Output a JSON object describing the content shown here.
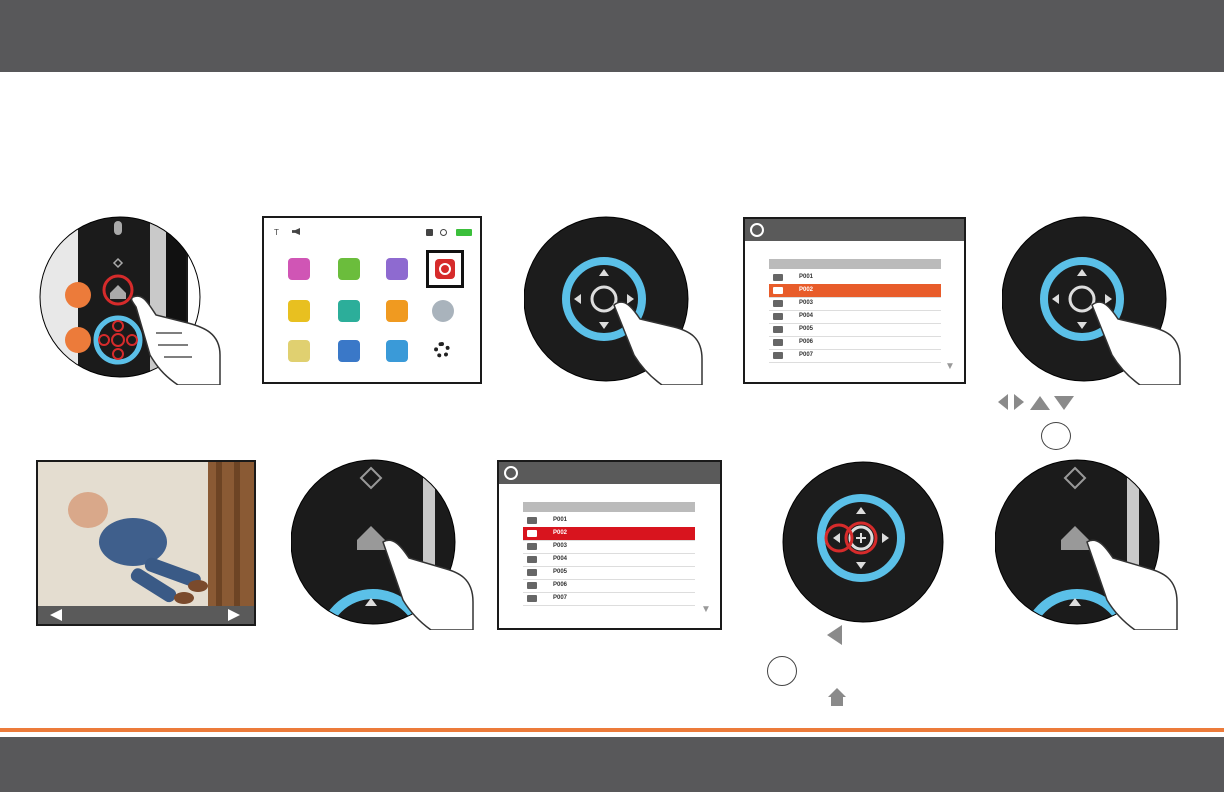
{
  "colors": {
    "header_bar": "#58585a",
    "accent_orange": "#ec7b3a",
    "selected_row_orange": "#e85c2a",
    "selected_row_red": "#d8141e",
    "ring_blue": "#5bc0e8",
    "highlight_red": "#d62b2b"
  },
  "steps": [
    {
      "id": 1,
      "depicts": "camera-home-button-press",
      "icons": [
        "microphone-icon",
        "dpad-icon",
        "home-icon",
        "hand-pointer-icon"
      ]
    },
    {
      "id": 2,
      "depicts": "home-menu-screen",
      "selected_icon": "playback-icon"
    },
    {
      "id": 3,
      "depicts": "center-button-press",
      "icons": [
        "dpad-ring-icon",
        "hand-pointer-icon"
      ]
    },
    {
      "id": 4,
      "depicts": "file-list-screen",
      "selected_index": 1
    },
    {
      "id": 5,
      "depicts": "center-button-press",
      "hint_icons": [
        "left-arrow-icon",
        "right-arrow-icon",
        "up-arrow-icon",
        "down-arrow-icon",
        "ok-circle-icon"
      ]
    },
    {
      "id": 6,
      "depicts": "photo-playback-screen"
    },
    {
      "id": 7,
      "depicts": "home-button-press"
    },
    {
      "id": 8,
      "depicts": "file-list-screen",
      "selected_index": 1
    },
    {
      "id": 9,
      "depicts": "left-and-center-button-highlight",
      "hint_icons": [
        "left-arrow-icon",
        "ok-circle-icon",
        "home-icon"
      ]
    },
    {
      "id": 10,
      "depicts": "home-button-press"
    }
  ],
  "home_menu": {
    "status_icons": [
      "text-size-icon",
      "speaker-icon",
      "lock-icon",
      "camera-icon",
      "battery-icon"
    ],
    "grid_icons": [
      "music-icon",
      "camera-icon",
      "video-icon",
      "playback-icon",
      "brightness-icon",
      "zoom-icon",
      "baby-icon",
      "disabled-icon",
      "light-icon",
      "pair-icon",
      "help-icon",
      "settings-icon"
    ]
  },
  "file_list": {
    "files": [
      "P001",
      "P002",
      "P003",
      "P004",
      "P005",
      "P006",
      "P007"
    ]
  }
}
